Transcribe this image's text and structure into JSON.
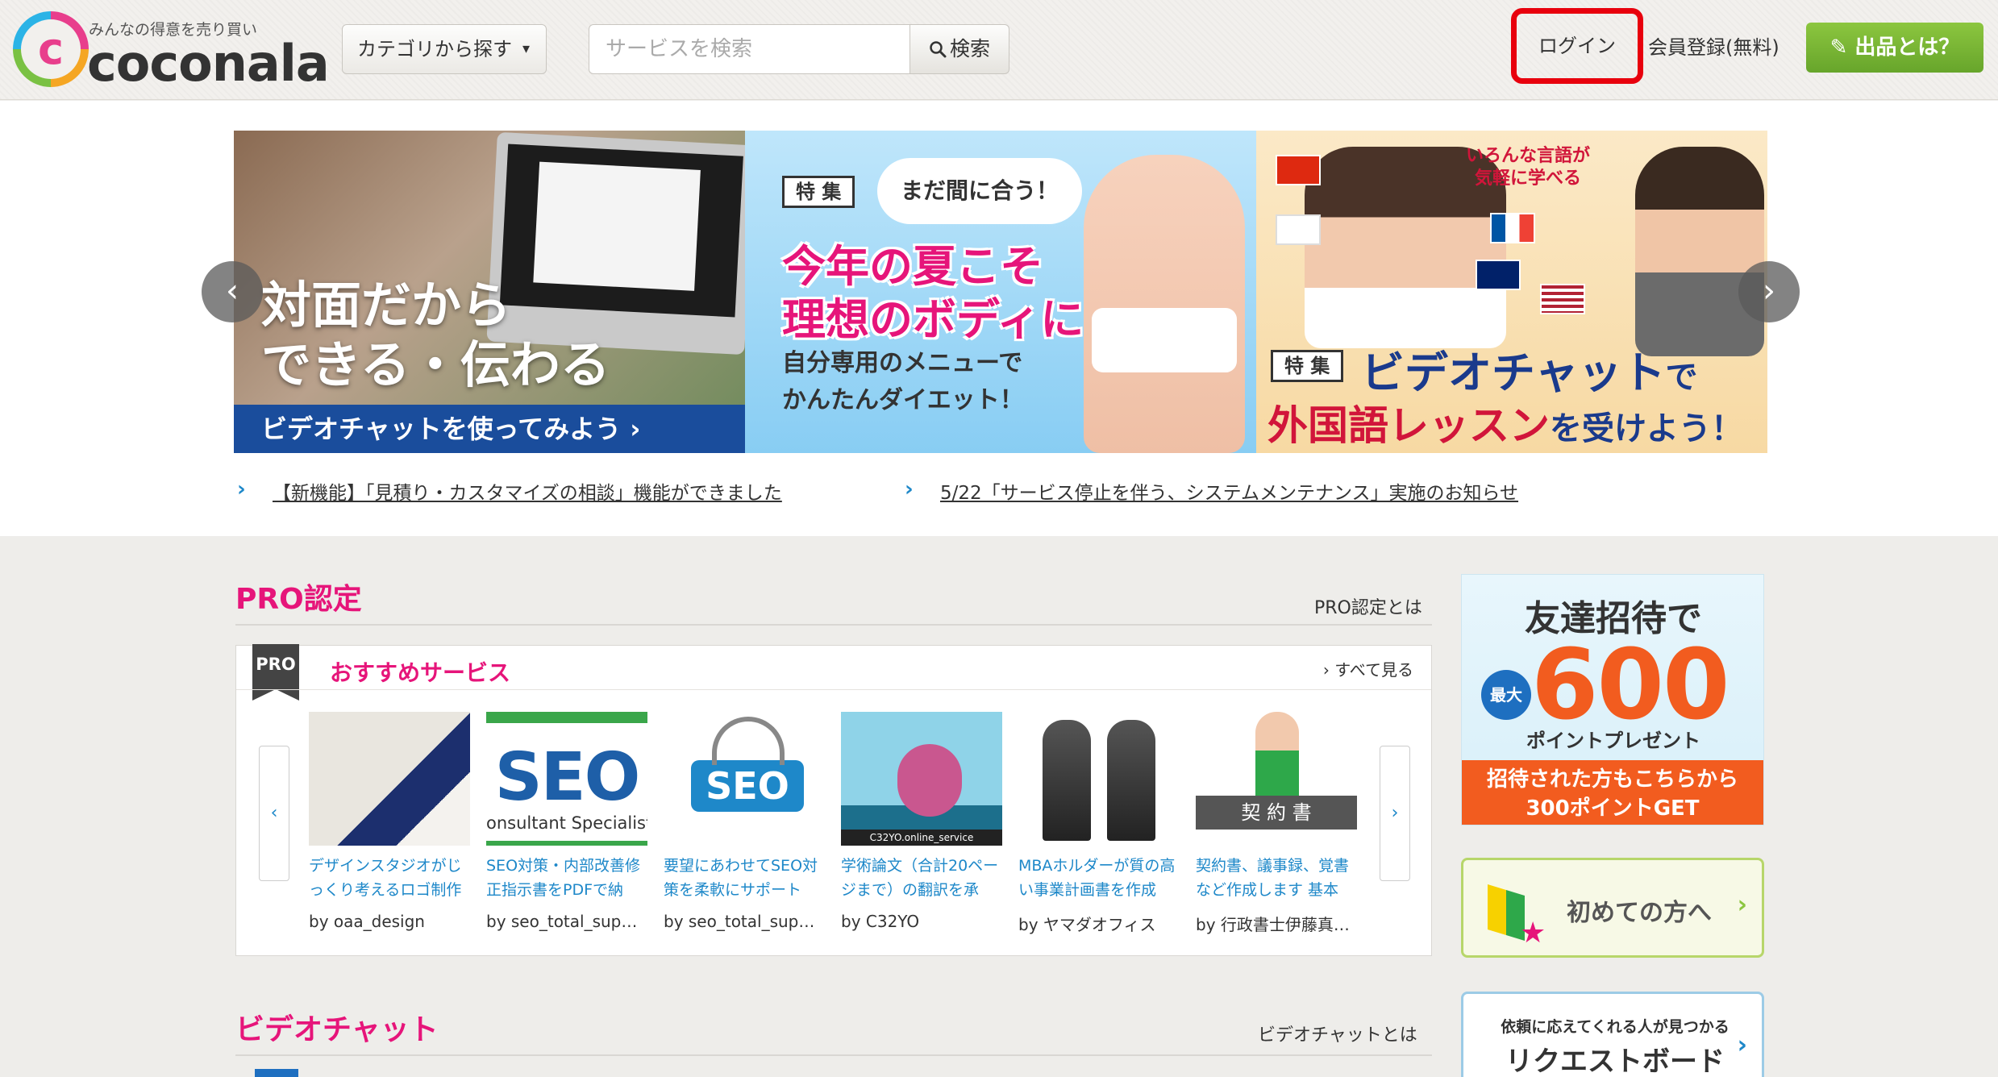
{
  "header": {
    "logo_tagline": "みんなの得意を売り買い",
    "logo_word": "coconala",
    "logo_mark": "c",
    "category_button": "カテゴリから探す",
    "category_chevron": "▾",
    "search_placeholder": "サービスを検索",
    "search_button": "検索",
    "login": "ログイン",
    "register": "会員登録(無料)",
    "sell_button": "出品とは？"
  },
  "hero": {
    "banner1": {
      "title_line1": "対面だから",
      "title_line2": "できる・伝わる",
      "bar": "ビデオチャットを使ってみよう ›"
    },
    "banner2": {
      "tag": "特 集",
      "bubble": "まだ間に合う！",
      "title_line1": "今年の夏こそ",
      "title_line2": "理想のボディに",
      "sub_line1": "自分専用のメニューで",
      "sub_line2": "かんたんダイエット！"
    },
    "banner3": {
      "tag": "特 集",
      "badge_line1": "いろんな言語が",
      "badge_line2": "気軽に学べる",
      "title1": "ビデオチャット",
      "title1_suffix": "で",
      "title2": "外国語レッスン",
      "title2_suffix": "を受けよう！"
    },
    "prev": "‹",
    "next": "›"
  },
  "news": [
    {
      "icon": "›",
      "text": "【新機能】「見積り・カスタマイズの相談」機能ができました"
    },
    {
      "icon": "›",
      "text": "5/22「サービス停止を伴う、システムメンテナンス」実施のお知らせ"
    }
  ],
  "pro_section": {
    "title": "PRO認定",
    "link": "PRO認定とは",
    "badge": "PRO",
    "subtitle": "おすすめサービス",
    "see_all": "› すべて見る",
    "prev": "‹",
    "next": "›",
    "cards": [
      {
        "title": "デザインスタジオがじっくり考えるロゴ制作",
        "by": "by oaa_design"
      },
      {
        "title": "SEO対策・内部改善修正指示書をPDFで納",
        "by": "by seo_total_supp…"
      },
      {
        "title": "要望にあわせてSEO対策を柔軟にサポート",
        "by": "by seo_total_supp…"
      },
      {
        "title": "学術論文（合計20ページまで）の翻訳を承",
        "by": "by C32YO"
      },
      {
        "title": "MBAホルダーが質の高い事業計画書を作成",
        "by": "by ヤマダオフィス"
      },
      {
        "title": "契約書、議事録、覚書など作成します 基本",
        "by": "by 行政書士伊藤真…"
      }
    ],
    "thumb_texts": {
      "seo_big": "SEO",
      "seo_caption": "onsultant Specialist",
      "seo_badge": "SEO",
      "c32yo": "C32YO.online_service",
      "contract": "契 約 書"
    }
  },
  "video_section": {
    "title": "ビデオチャット",
    "link": "ビデオチャットとは"
  },
  "sidebar": {
    "invite": {
      "line1": "友達招待で",
      "max": "最大",
      "number": "600",
      "points": "ポイントプレゼント",
      "bar_line1": "招待された方もこちらから",
      "bar_line2": "300ポイントGET"
    },
    "beginner": {
      "text": "初めての方へ",
      "arrow": "›"
    },
    "request": {
      "sub": "依頼に応えてくれる人が見つかる",
      "main": "リクエストボード",
      "arrow": "›"
    }
  },
  "colors": {
    "brand_pink": "#e6157a",
    "brand_green": "#8cc63f",
    "link_blue": "#1e88c9",
    "login_highlight": "#e8000d"
  }
}
